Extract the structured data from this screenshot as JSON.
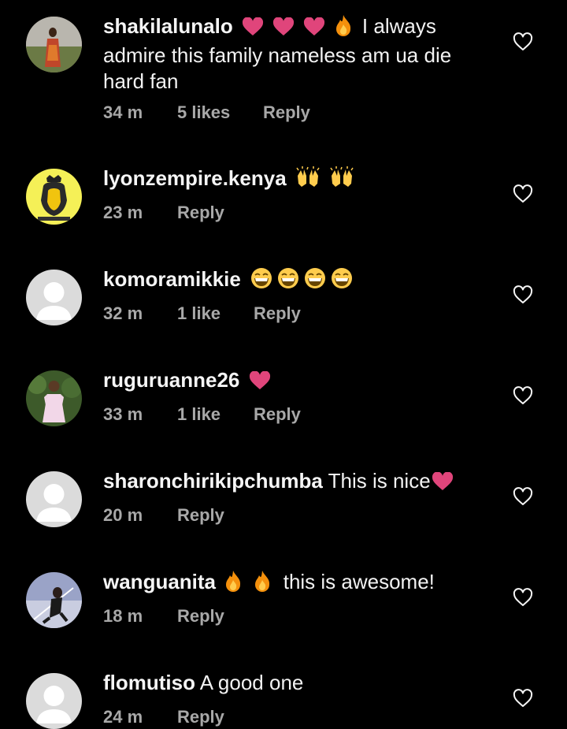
{
  "comments": [
    {
      "username": "shakilalunalo",
      "text": "I always admire this family nameless am ua die hard fan",
      "emojis": [
        "heart",
        "heart",
        "heart",
        "fire"
      ],
      "time": "34 m",
      "likes": "5 likes",
      "reply": "Reply"
    },
    {
      "username": "lyonzempire.kenya",
      "text": "",
      "emojis": [
        "raising-hands",
        "raising-hands"
      ],
      "time": "23 m",
      "likes": "",
      "reply": "Reply"
    },
    {
      "username": "komoramikkie",
      "text": "",
      "emojis": [
        "grin",
        "grin",
        "grin",
        "grin"
      ],
      "time": "32 m",
      "likes": "1 like",
      "reply": "Reply"
    },
    {
      "username": "ruguruanne26",
      "text": "",
      "emojis": [
        "heart"
      ],
      "time": "33 m",
      "likes": "1 like",
      "reply": "Reply"
    },
    {
      "username": "sharonchirikipchumba",
      "text": "This is nice",
      "emojis": [
        "heart"
      ],
      "time": "20 m",
      "likes": "",
      "reply": "Reply"
    },
    {
      "username": "wanguanita",
      "text": "this is awesome!",
      "emojis": [
        "fire",
        "fire"
      ],
      "time": "18 m",
      "likes": "",
      "reply": "Reply"
    },
    {
      "username": "flomutiso",
      "text": "A good one",
      "emojis": [],
      "time": "24 m",
      "likes": "",
      "reply": "Reply"
    }
  ],
  "colors": {
    "background": "#000000",
    "text": "#f5f5f5",
    "meta": "#a8a8a8",
    "heart_emoji": "#e0457b",
    "fire_emoji": "#f4900c"
  }
}
